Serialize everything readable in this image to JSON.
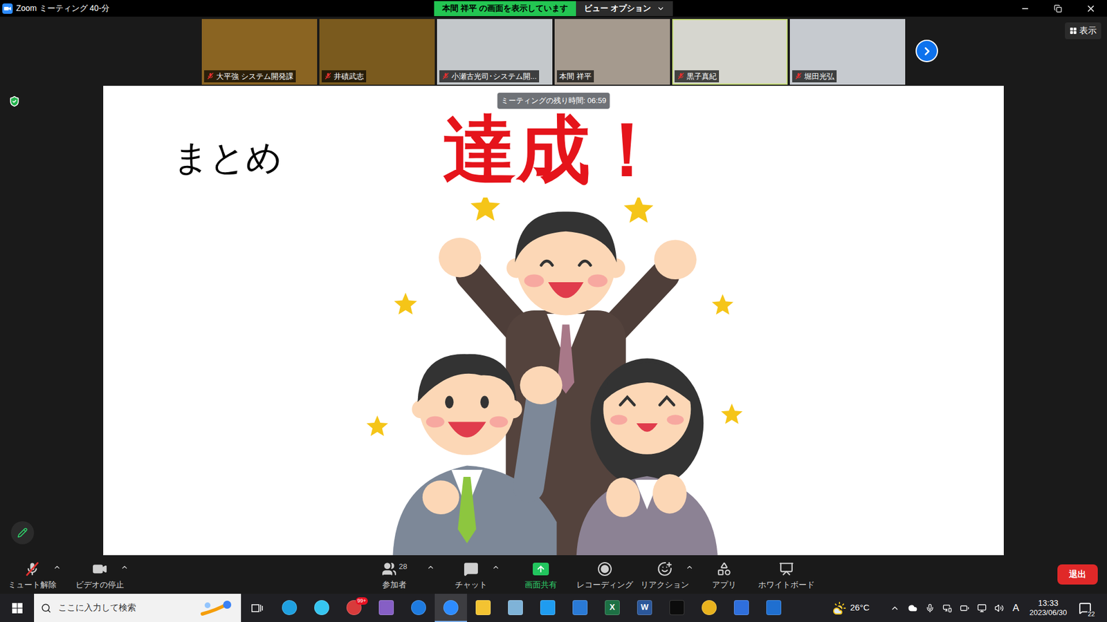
{
  "window": {
    "title": "Zoom ミーティング 40-分"
  },
  "share_banner": {
    "text": "本間 祥平 の画面を表示しています",
    "view_options": "ビュー オプション"
  },
  "gallery": {
    "participants": [
      {
        "name": "大平強 システム開発課",
        "muted": true,
        "speaking": false,
        "color": "#8a6422"
      },
      {
        "name": "井磧武志",
        "muted": true,
        "speaking": false,
        "color": "#7a5a1e"
      },
      {
        "name": "小瀬古光司･システム開...",
        "muted": true,
        "speaking": false,
        "color": "#c4c8cb"
      },
      {
        "name": "本間 祥平",
        "muted": false,
        "speaking": false,
        "color": "#a59a8e"
      },
      {
        "name": "黒子真紀",
        "muted": true,
        "speaking": true,
        "color": "#d6d6cf"
      },
      {
        "name": "堀田光弘",
        "muted": true,
        "speaking": false,
        "color": "#c6cacf"
      }
    ],
    "view_button": "表示"
  },
  "meeting_timer": "ミーティングの残り時間: 06:59",
  "slide": {
    "heading": "まとめ",
    "banner": "達成！"
  },
  "toolbar": {
    "left_items": [
      {
        "label": "ミュート解除",
        "kind": "mic",
        "caret": true,
        "highlighted": false
      },
      {
        "label": "ビデオの停止",
        "kind": "video",
        "caret": true,
        "highlighted": false
      }
    ],
    "center_items": [
      {
        "label": "参加者",
        "kind": "participants",
        "caret": true,
        "highlighted": false,
        "count": "28"
      },
      {
        "label": "チャット",
        "kind": "chat",
        "caret": true,
        "highlighted": false
      },
      {
        "label": "画面共有",
        "kind": "share",
        "caret": false,
        "highlighted": true
      },
      {
        "label": "レコーディング",
        "kind": "record",
        "caret": false,
        "highlighted": false
      },
      {
        "label": "リアクション",
        "kind": "reactions",
        "caret": true,
        "highlighted": false
      },
      {
        "label": "アプリ",
        "kind": "apps",
        "caret": false,
        "highlighted": false
      },
      {
        "label": "ホワイトボード",
        "kind": "whiteboard",
        "caret": false,
        "highlighted": false
      }
    ],
    "leave_button": "退出"
  },
  "taskbar": {
    "search_placeholder": "ここに入力して検索",
    "apps": [
      {
        "kind": "circle",
        "color": "#1fa0e0",
        "active": false
      },
      {
        "kind": "circle",
        "color": "#36c5f0",
        "active": false
      },
      {
        "kind": "circle",
        "color": "#d83b3b",
        "active": false,
        "badge": "99+"
      },
      {
        "kind": "square",
        "color": "#865fc5",
        "active": false
      },
      {
        "kind": "circle",
        "color": "#1e7be0",
        "active": false
      },
      {
        "kind": "circle",
        "color": "#2d8cff",
        "active": true
      },
      {
        "kind": "square",
        "color": "#f3c332",
        "active": false
      },
      {
        "kind": "square",
        "color": "#7fb3d8",
        "active": false
      },
      {
        "kind": "square",
        "color": "#1f9cf0",
        "active": false
      },
      {
        "kind": "square",
        "color": "#2a7ad6",
        "active": false
      },
      {
        "kind": "square",
        "color": "#1d7044",
        "active": false,
        "glyph": "X"
      },
      {
        "kind": "square",
        "color": "#2b579a",
        "active": false,
        "glyph": "W"
      },
      {
        "kind": "square",
        "color": "#0c0c0c",
        "active": false
      },
      {
        "kind": "circle",
        "color": "#e8b21e",
        "active": false
      },
      {
        "kind": "square",
        "color": "#2f6fdc",
        "active": false
      },
      {
        "kind": "square",
        "color": "#1f6fd0",
        "active": false
      }
    ],
    "weather": "26°C",
    "input_mode": "A",
    "time": "13:33",
    "date": "2023/06/30",
    "notifications": "22"
  }
}
